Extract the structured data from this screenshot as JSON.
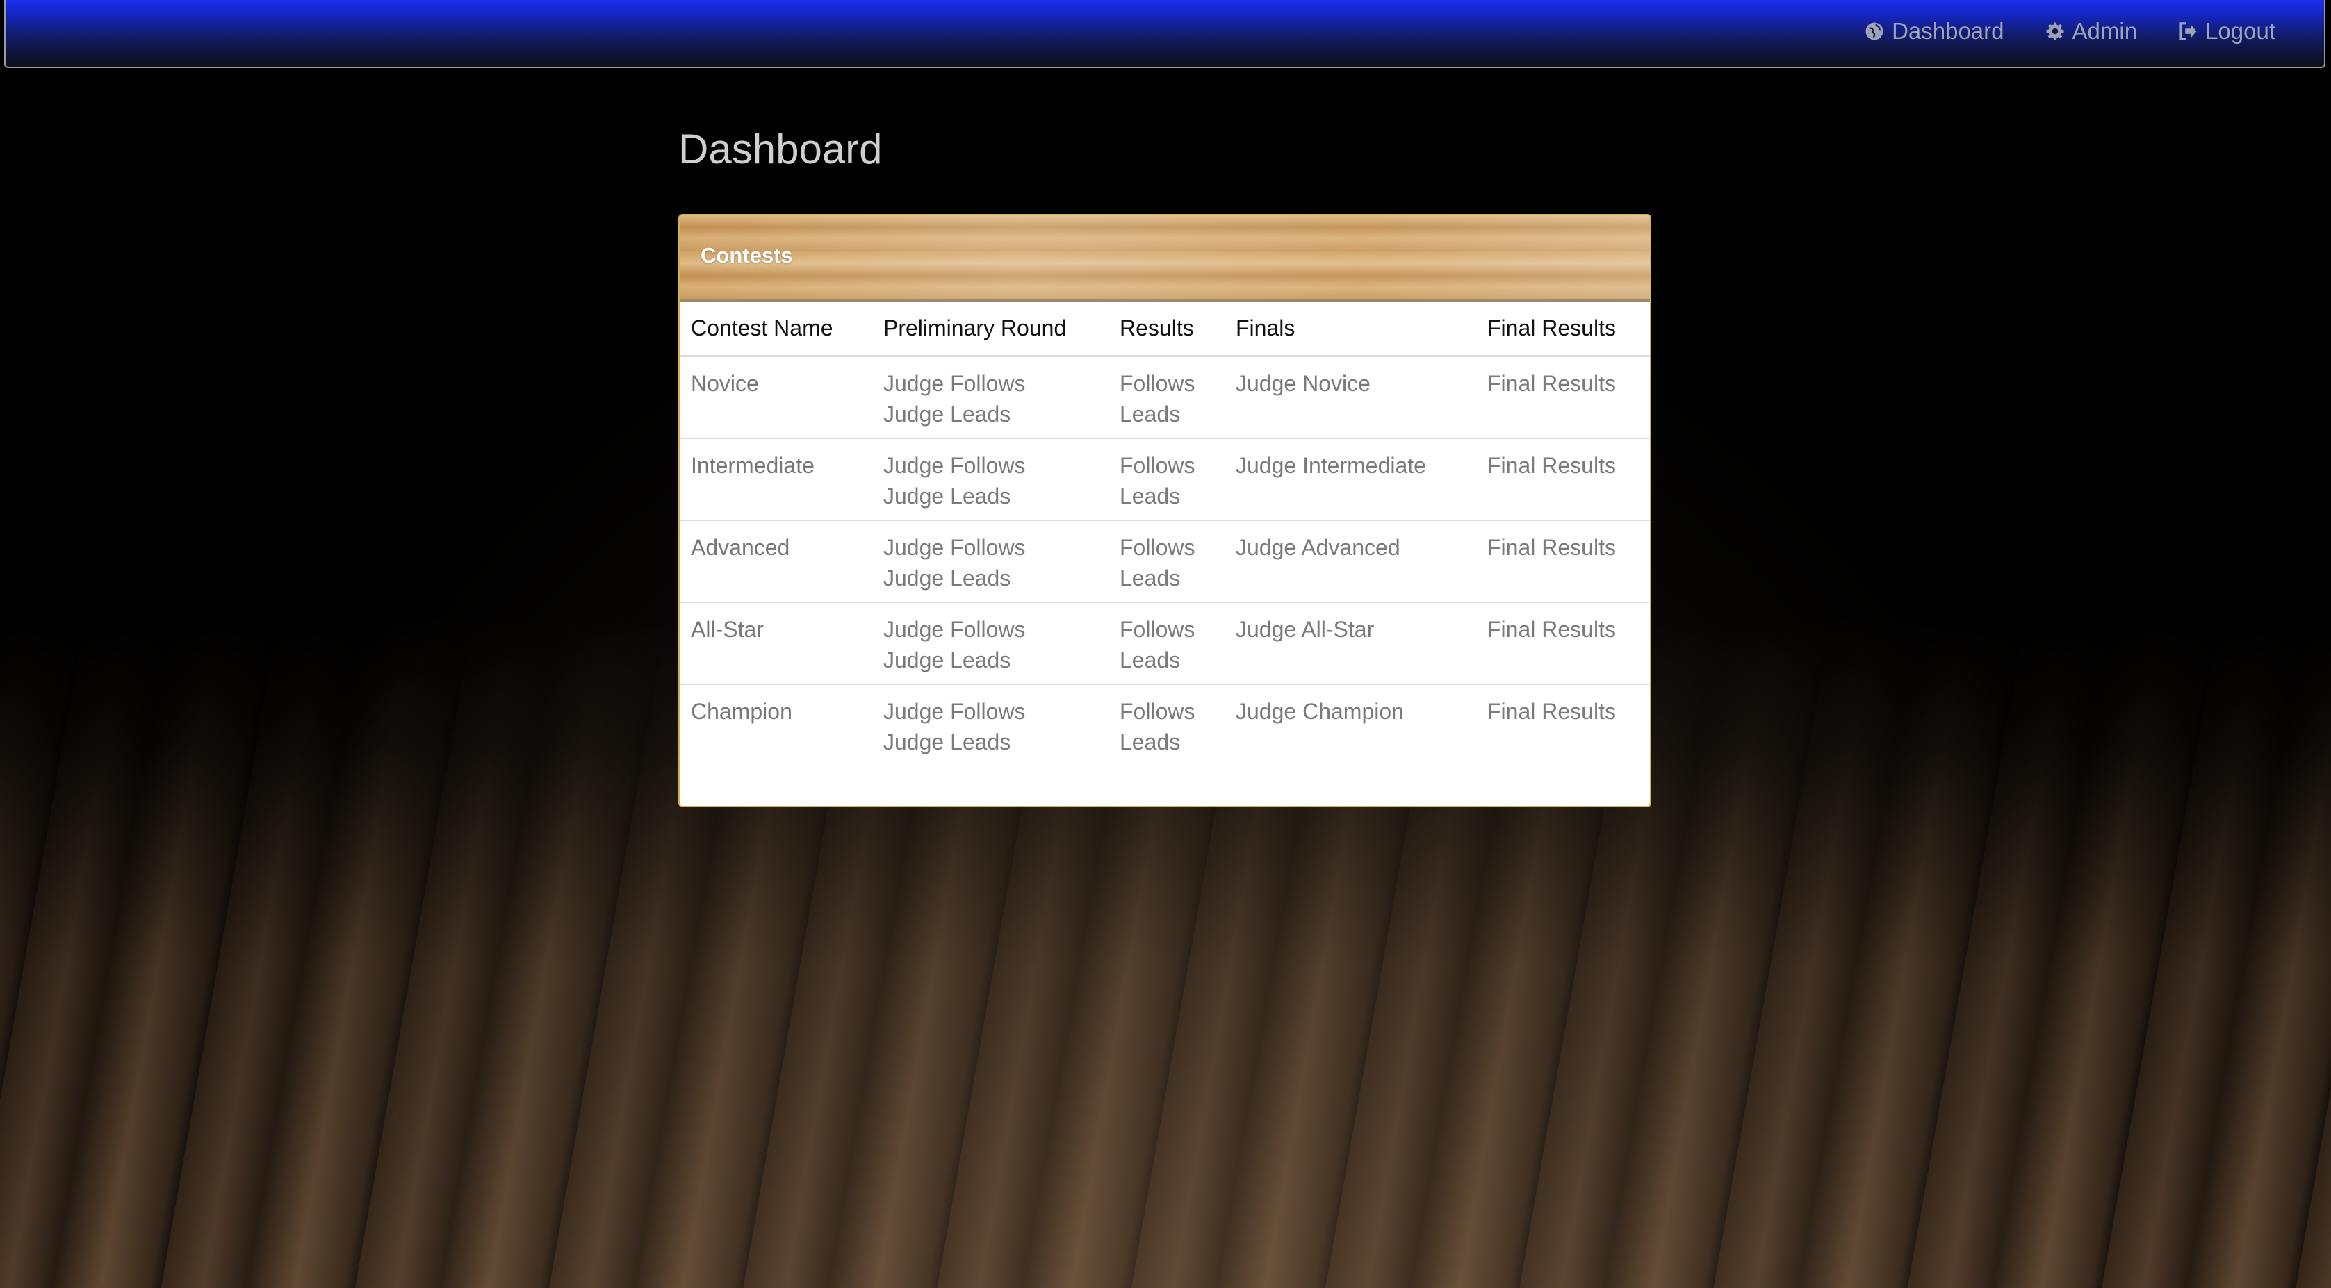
{
  "nav": {
    "links": [
      {
        "label": "Dashboard",
        "icon": "globe-icon"
      },
      {
        "label": "Admin",
        "icon": "gear-icon"
      },
      {
        "label": "Logout",
        "icon": "logout-icon"
      }
    ]
  },
  "page": {
    "title": "Dashboard"
  },
  "panel": {
    "title": "Contests",
    "columns": [
      "Contest Name",
      "Preliminary Round",
      "Results",
      "Finals",
      "Final Results"
    ],
    "rows": [
      {
        "name": "Novice",
        "prelim": [
          "Judge Follows",
          "Judge Leads"
        ],
        "results": [
          "Follows",
          "Leads"
        ],
        "finals": "Judge Novice",
        "final_results": "Final Results"
      },
      {
        "name": "Intermediate",
        "prelim": [
          "Judge Follows",
          "Judge Leads"
        ],
        "results": [
          "Follows",
          "Leads"
        ],
        "finals": "Judge Intermediate",
        "final_results": "Final Results"
      },
      {
        "name": "Advanced",
        "prelim": [
          "Judge Follows",
          "Judge Leads"
        ],
        "results": [
          "Follows",
          "Leads"
        ],
        "finals": "Judge Advanced",
        "final_results": "Final Results"
      },
      {
        "name": "All-Star",
        "prelim": [
          "Judge Follows",
          "Judge Leads"
        ],
        "results": [
          "Follows",
          "Leads"
        ],
        "finals": "Judge All-Star",
        "final_results": "Final Results"
      },
      {
        "name": "Champion",
        "prelim": [
          "Judge Follows",
          "Judge Leads"
        ],
        "results": [
          "Follows",
          "Leads"
        ],
        "finals": "Judge Champion",
        "final_results": "Final Results"
      }
    ]
  },
  "colors": {
    "navbar_top": "#1a2ff0",
    "panel_border": "#d4b24a",
    "link_text": "#777777"
  }
}
